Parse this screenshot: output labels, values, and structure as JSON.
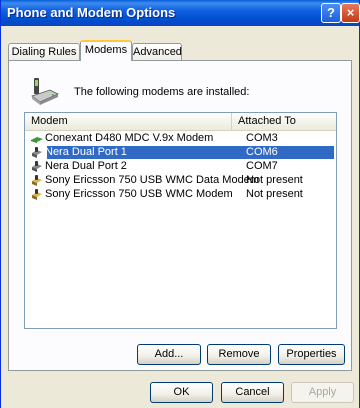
{
  "window": {
    "title": "Phone and Modem Options",
    "help": "?",
    "close": "×"
  },
  "tabs": [
    {
      "label": "Dialing Rules",
      "active": false
    },
    {
      "label": "Modems",
      "active": true
    },
    {
      "label": "Advanced",
      "active": false
    }
  ],
  "intro_text": "The following modems are installed:",
  "columns": {
    "modem": "Modem",
    "attached": "Attached To"
  },
  "rows": [
    {
      "name": "Conexant D480 MDC V.9x Modem",
      "port": "COM3",
      "selected": false,
      "icon": "modem-icon"
    },
    {
      "name": "Nera Dual Port 1",
      "port": "COM6",
      "selected": true,
      "icon": "phone-modem-icon"
    },
    {
      "name": "Nera Dual Port 2",
      "port": "COM7",
      "selected": false,
      "icon": "phone-modem-icon"
    },
    {
      "name": "Sony Ericsson 750 USB WMC Data Modem",
      "port": "Not present",
      "selected": false,
      "icon": "phone-modem-icon"
    },
    {
      "name": "Sony Ericsson 750 USB WMC Modem",
      "port": "Not present",
      "selected": false,
      "icon": "phone-modem-icon"
    }
  ],
  "buttons": {
    "add": "Add...",
    "remove": "Remove",
    "properties": "Properties",
    "ok": "OK",
    "cancel": "Cancel",
    "apply": "Apply"
  },
  "colors": {
    "titlebar": "#0a5fd8",
    "selection": "#316ac5",
    "active_tab_highlight": "#ffc73c"
  }
}
